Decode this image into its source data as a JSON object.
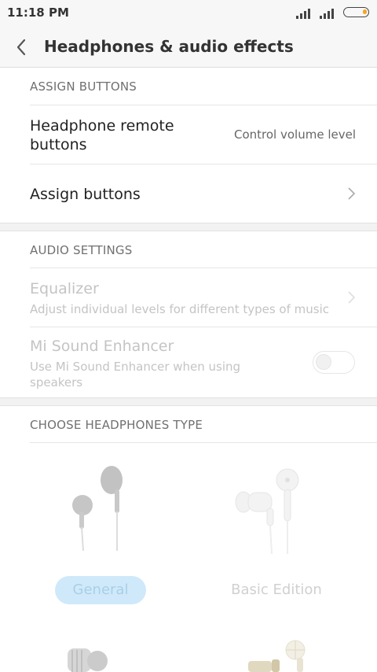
{
  "status_bar": {
    "time": "11:18 PM",
    "icons": [
      "signal-1-icon",
      "signal-2-icon",
      "battery-icon"
    ],
    "battery_accent": "#f5a623"
  },
  "header": {
    "title": "Headphones & audio effects",
    "back_icon": "chevron-left-icon"
  },
  "assign_section": {
    "header": "ASSIGN BUTTONS",
    "remote_row": {
      "title_line1": "Headphone remote",
      "title_line2": "buttons",
      "value": "Control volume level"
    },
    "assign_row": {
      "title": "Assign buttons",
      "icon": "chevron-right-icon"
    }
  },
  "audio_section": {
    "header": "AUDIO SETTINGS",
    "equalizer": {
      "title": "Equalizer",
      "subtitle": "Adjust individual levels for different types of music",
      "icon": "chevron-right-icon"
    },
    "enhancer": {
      "title": "Mi Sound Enhancer",
      "subtitle_line1": "Use Mi Sound Enhancer when using",
      "subtitle_line2": "speakers",
      "toggle_on": false
    }
  },
  "headphones_section": {
    "header": "CHOOSE HEADPHONES TYPE",
    "options": [
      {
        "label": "General",
        "selected": true,
        "icon": "earbuds-icon"
      },
      {
        "label": "Basic Edition",
        "selected": false,
        "icon": "in-ear-headphones-icon"
      }
    ],
    "selected_color": "#cfe9fb"
  }
}
